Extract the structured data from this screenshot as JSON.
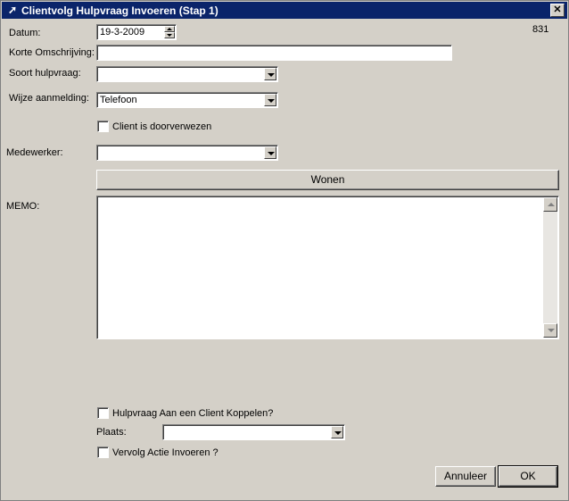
{
  "window": {
    "title": "Clientvolg Hulpvraag Invoeren (Stap 1)",
    "close_label": "✕",
    "record_number": "831"
  },
  "form": {
    "datum_label": "Datum:",
    "datum_value": "19-3-2009",
    "korte_omschrijving_label": "Korte Omschrijving:",
    "korte_omschrijving_value": "",
    "soort_hulpvraag_label": "Soort hulpvraag:",
    "soort_hulpvraag_value": "",
    "wijze_aanmelding_label": "Wijze aanmelding:",
    "wijze_aanmelding_value": "Telefoon",
    "client_doorverwezen_label": "Client is doorverwezen",
    "client_doorverwezen_checked": false,
    "medewerker_label": "Medewerker:",
    "medewerker_value": "",
    "wonen_button_label": "Wonen",
    "memo_label": "MEMO:",
    "memo_value": "",
    "koppelen_label": "Hulpvraag Aan een Client Koppelen?",
    "koppelen_checked": false,
    "plaats_label": "Plaats:",
    "plaats_value": "",
    "vervolg_label": "Vervolg Actie Invoeren ?",
    "vervolg_checked": false
  },
  "buttons": {
    "cancel_label": "Annuleer",
    "ok_label": "OK"
  }
}
